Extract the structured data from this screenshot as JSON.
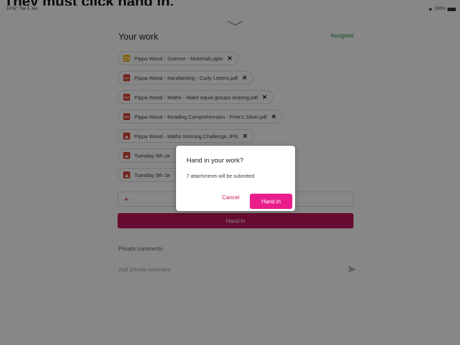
{
  "caption": "They must click hand in.",
  "statusbar": {
    "time": "14:52",
    "date": "Tue 5 Jan",
    "battery": "100%"
  },
  "page": {
    "title": "Your work",
    "status": "Assigned",
    "attachments": [
      {
        "name": "Pippa Wood - Science - Materials.pptx",
        "type": "slides",
        "icon": "slides-file-icon"
      },
      {
        "name": "Pippa Wood - Handwriting - Curly Letters.pdf",
        "type": "pdf",
        "icon": "pdf-file-icon",
        "badge": "PDF"
      },
      {
        "name": "Pippa Wood - Maths - Make equal groups sharing.pdf",
        "type": "pdf",
        "icon": "pdf-file-icon",
        "badge": "PDF"
      },
      {
        "name": "Pippa Wood - Reading Comprehension - Pete's Silver.pdf",
        "type": "pdf",
        "icon": "pdf-file-icon",
        "badge": "PDF"
      },
      {
        "name": "Pippa Wood - Maths Morning Challenge.JPG",
        "type": "img",
        "icon": "image-file-icon"
      },
      {
        "name": "Tuesday 5th Ja",
        "type": "img",
        "icon": "image-file-icon"
      },
      {
        "name": "Tuesday 5th Ja",
        "type": "img",
        "icon": "image-file-icon"
      }
    ],
    "add_label": "+",
    "hand_in_label": "Hand in",
    "private_comments_title": "Private comments",
    "comment_placeholder": "Add private comment"
  },
  "dialog": {
    "title": "Hand in your work?",
    "message": "7 attachments will be submitted",
    "cancel_label": "Cancel",
    "confirm_label": "Hand in"
  },
  "colors": {
    "accent": "#c2185b",
    "confirm": "#e91e8c",
    "assigned": "#1e8e3e"
  }
}
